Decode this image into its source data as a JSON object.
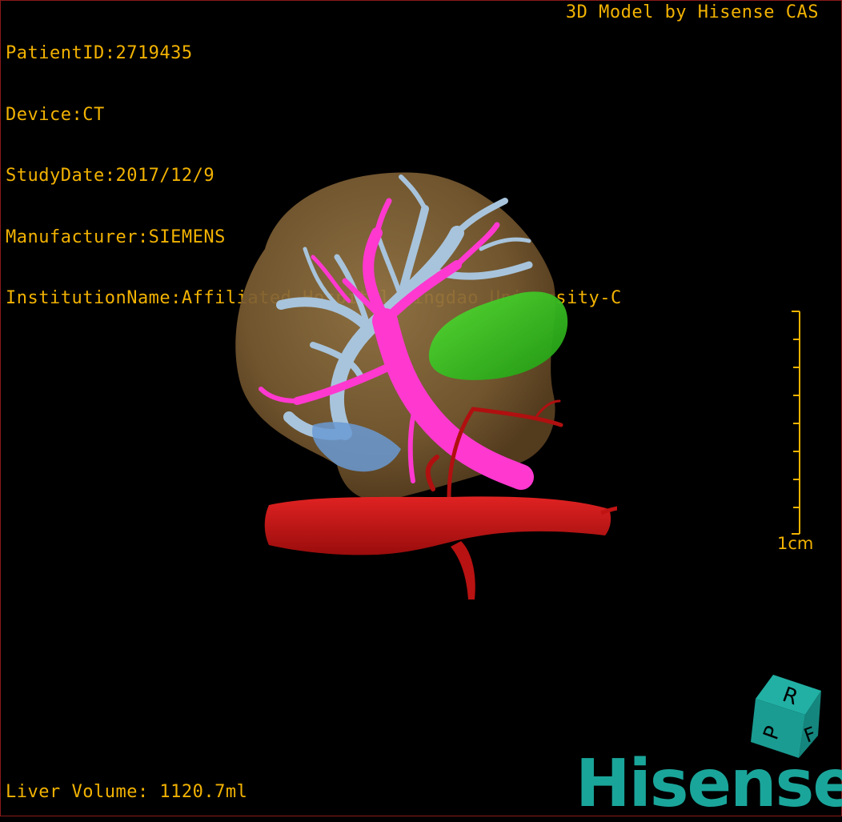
{
  "overlay": {
    "patient_id": "PatientID:2719435",
    "device": "Device:CT",
    "study_date": "StudyDate:2017/12/9",
    "manufacturer": "Manufacturer:SIEMENS",
    "institution": "InstitutionName:Affiliated Hospital Qingdao University-C",
    "brand_top": "3D Model by Hisense CAS",
    "liver_volume": "Liver Volume: 1120.7ml"
  },
  "scale": {
    "label": "1cm"
  },
  "orientation_cube": {
    "letters": [
      "P",
      "R",
      "F"
    ]
  },
  "logo": {
    "text": "Hisense"
  },
  "colors": {
    "overlay_text": "#f2b200",
    "liver": "#8a6a3a",
    "hepatic_vein": "#a8c4dc",
    "portal_vein": "#ff38d0",
    "artery": "#d01818",
    "gallbladder": "#33cc22",
    "cube": "#1aa59a",
    "logo": "#1aa59a"
  }
}
